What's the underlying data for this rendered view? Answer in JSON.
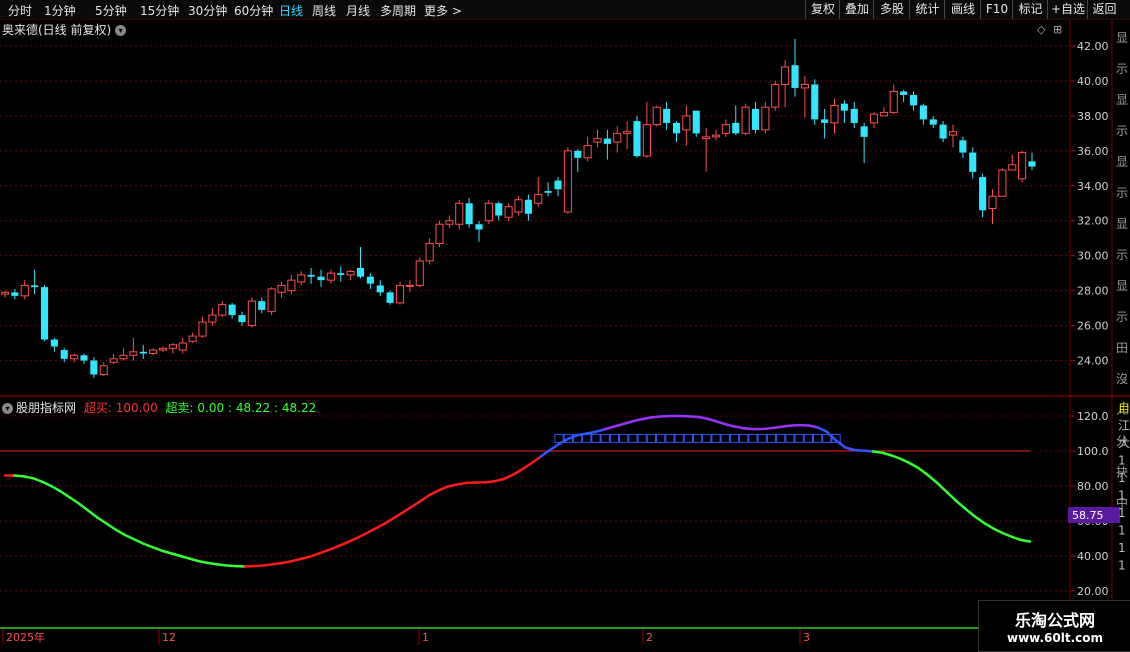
{
  "toolbar": {
    "periods": [
      "分时",
      "1分钟",
      "5分钟",
      "15分钟",
      "30分钟",
      "60分钟",
      "日线",
      "周线",
      "月线",
      "多周期",
      "更多 >"
    ],
    "active_period": "日线",
    "right_buttons": [
      "复权",
      "叠加",
      "多股",
      "统计",
      "画线",
      "F10",
      "标记",
      "+自选",
      "返回"
    ]
  },
  "main_chart": {
    "title": "奥来德(日线 前复权)",
    "y_ticks": [
      "42.00",
      "40.00",
      "38.00",
      "36.00",
      "34.00",
      "32.00",
      "30.00",
      "28.00",
      "26.00",
      "24.00"
    ],
    "right_panel_glyphs": "显示显示显示显示显示田沒ㄦ分抉中"
  },
  "indicator": {
    "name": "股朋指标网",
    "label_buy": "超买:",
    "value_buy": "100.00",
    "label_sell": "超卖:",
    "value_sell": "0.00",
    "value_line1": ": 48.22",
    "value_line2": ": 48.22",
    "y_ticks": [
      "120.0",
      "100.0",
      "80.00",
      "60.00",
      "40.00",
      "20.00"
    ],
    "current_value": "58.75",
    "right_panel_glyphs": "自江大1111111"
  },
  "x_axis": {
    "labels": [
      "2025年",
      "12",
      "1",
      "2",
      "3"
    ]
  },
  "watermark": {
    "line1": "乐淘公式网",
    "line2": "www.60lt.com"
  },
  "colors": {
    "up": "#ff4d4d",
    "down": "#33e6ff",
    "grid": "#6a0000",
    "line_green": "#33ff33",
    "line_red": "#ff1a1a",
    "line_blue": "#3355ff",
    "line_purple": "#9933ff",
    "badge": "#5a1aa0"
  },
  "chart_data": {
    "type": "candlestick",
    "title": "奥来德(日线 前复权)",
    "ylim": [
      22.5,
      43.5
    ],
    "candles": [
      [
        27.8,
        27.9,
        27.6,
        28.0
      ],
      [
        27.9,
        27.7,
        27.5,
        28.1
      ],
      [
        27.7,
        28.3,
        27.5,
        28.6
      ],
      [
        28.3,
        28.2,
        27.8,
        29.2
      ],
      [
        28.2,
        25.2,
        25.1,
        28.3
      ],
      [
        25.2,
        24.8,
        24.5,
        25.3
      ],
      [
        24.6,
        24.1,
        23.9,
        24.7
      ],
      [
        24.1,
        24.3,
        23.9,
        24.4
      ],
      [
        24.3,
        24.0,
        23.8,
        24.4
      ],
      [
        24.0,
        23.2,
        23.0,
        24.2
      ],
      [
        23.2,
        23.7,
        23.1,
        23.9
      ],
      [
        23.9,
        24.1,
        23.8,
        24.4
      ],
      [
        24.1,
        24.3,
        24.0,
        24.7
      ],
      [
        24.3,
        24.5,
        24.0,
        25.3
      ],
      [
        24.5,
        24.4,
        24.1,
        24.9
      ],
      [
        24.4,
        24.6,
        24.3,
        24.7
      ],
      [
        24.6,
        24.7,
        24.5,
        24.8
      ],
      [
        24.7,
        24.9,
        24.4,
        25.0
      ],
      [
        24.6,
        25.0,
        24.4,
        25.3
      ],
      [
        25.1,
        25.4,
        25.0,
        25.6
      ],
      [
        25.4,
        26.2,
        25.3,
        26.5
      ],
      [
        26.2,
        26.6,
        26.0,
        27.0
      ],
      [
        26.6,
        27.2,
        26.5,
        27.4
      ],
      [
        27.2,
        26.6,
        26.4,
        27.3
      ],
      [
        26.6,
        26.2,
        26.0,
        26.8
      ],
      [
        26.0,
        27.4,
        25.9,
        27.6
      ],
      [
        27.4,
        26.9,
        26.7,
        27.6
      ],
      [
        26.8,
        28.1,
        26.6,
        28.2
      ],
      [
        27.9,
        28.3,
        27.6,
        28.5
      ],
      [
        28.0,
        28.6,
        27.8,
        28.9
      ],
      [
        28.5,
        28.9,
        28.3,
        29.1
      ],
      [
        28.9,
        28.8,
        28.4,
        29.3
      ],
      [
        28.8,
        28.6,
        28.2,
        29.2
      ],
      [
        28.6,
        29.0,
        28.4,
        29.2
      ],
      [
        29.0,
        28.9,
        28.5,
        29.4
      ],
      [
        28.9,
        29.1,
        28.6,
        29.2
      ],
      [
        29.3,
        28.8,
        28.7,
        30.5
      ],
      [
        28.8,
        28.4,
        28.1,
        29.0
      ],
      [
        28.3,
        27.9,
        27.7,
        28.6
      ],
      [
        27.9,
        27.3,
        27.2,
        28.0
      ],
      [
        27.3,
        28.3,
        27.2,
        28.5
      ],
      [
        28.3,
        28.3,
        27.9,
        28.6
      ],
      [
        28.3,
        29.7,
        28.2,
        29.9
      ],
      [
        29.7,
        30.7,
        29.5,
        31.0
      ],
      [
        30.7,
        31.8,
        30.5,
        32.0
      ],
      [
        31.8,
        32.0,
        31.6,
        32.3
      ],
      [
        31.8,
        33.0,
        31.5,
        33.2
      ],
      [
        33.0,
        31.8,
        31.6,
        33.3
      ],
      [
        31.8,
        31.5,
        30.8,
        32.0
      ],
      [
        32.0,
        33.0,
        31.8,
        33.2
      ],
      [
        33.0,
        32.3,
        32.0,
        33.1
      ],
      [
        32.2,
        32.8,
        32.0,
        33.0
      ],
      [
        32.5,
        33.2,
        32.3,
        33.4
      ],
      [
        33.2,
        32.4,
        32.0,
        33.5
      ],
      [
        33.0,
        33.5,
        32.8,
        34.5
      ],
      [
        33.7,
        33.6,
        33.4,
        34.2
      ],
      [
        34.3,
        33.8,
        33.4,
        34.5
      ],
      [
        32.5,
        36.0,
        32.4,
        36.2
      ],
      [
        36.0,
        35.6,
        34.8,
        36.1
      ],
      [
        35.6,
        36.3,
        35.4,
        36.8
      ],
      [
        36.5,
        36.7,
        36.2,
        37.2
      ],
      [
        36.7,
        36.4,
        35.5,
        37.2
      ],
      [
        36.5,
        37.0,
        35.9,
        37.4
      ],
      [
        37.0,
        37.1,
        36.1,
        37.7
      ],
      [
        37.7,
        35.7,
        35.6,
        38.0
      ],
      [
        35.7,
        37.5,
        35.6,
        38.8
      ],
      [
        37.5,
        38.5,
        37.4,
        38.6
      ],
      [
        38.4,
        37.6,
        37.2,
        38.8
      ],
      [
        37.6,
        37.0,
        36.5,
        37.7
      ],
      [
        37.2,
        38.0,
        36.3,
        38.6
      ],
      [
        38.3,
        37.0,
        36.8,
        38.3
      ],
      [
        36.7,
        36.8,
        34.8,
        37.3
      ],
      [
        36.8,
        36.9,
        36.6,
        37.2
      ],
      [
        37.0,
        37.5,
        36.8,
        37.8
      ],
      [
        37.6,
        37.0,
        36.9,
        38.6
      ],
      [
        37.0,
        38.5,
        36.9,
        38.7
      ],
      [
        38.4,
        37.2,
        37.0,
        38.8
      ],
      [
        37.2,
        38.5,
        37.0,
        38.8
      ],
      [
        38.5,
        39.8,
        38.3,
        40.0
      ],
      [
        39.8,
        40.8,
        38.5,
        41.2
      ],
      [
        40.9,
        39.6,
        39.1,
        42.4
      ],
      [
        39.6,
        39.8,
        37.9,
        40.3
      ],
      [
        39.8,
        37.8,
        37.5,
        40.1
      ],
      [
        37.8,
        37.6,
        36.7,
        38.4
      ],
      [
        37.6,
        38.6,
        37.0,
        39.0
      ],
      [
        38.7,
        38.3,
        37.6,
        38.9
      ],
      [
        38.4,
        37.6,
        37.3,
        38.8
      ],
      [
        37.4,
        36.8,
        35.3,
        37.6
      ],
      [
        37.6,
        38.1,
        37.3,
        38.2
      ],
      [
        38.0,
        38.2,
        38.0,
        38.5
      ],
      [
        38.2,
        39.4,
        38.1,
        39.8
      ],
      [
        39.4,
        39.2,
        38.8,
        39.5
      ],
      [
        39.2,
        38.6,
        38.3,
        39.4
      ],
      [
        38.6,
        37.8,
        37.5,
        38.7
      ],
      [
        37.8,
        37.5,
        37.3,
        38.0
      ],
      [
        37.5,
        36.7,
        36.5,
        37.7
      ],
      [
        36.9,
        37.1,
        36.2,
        37.5
      ],
      [
        36.6,
        35.9,
        35.6,
        36.8
      ],
      [
        35.9,
        34.8,
        34.4,
        36.2
      ],
      [
        34.5,
        32.6,
        32.2,
        34.7
      ],
      [
        32.7,
        33.4,
        31.8,
        33.8
      ],
      [
        33.4,
        34.9,
        33.4,
        35.0
      ],
      [
        34.9,
        35.2,
        34.9,
        35.8
      ],
      [
        34.4,
        35.9,
        34.2,
        36.0
      ],
      [
        35.4,
        35.1,
        34.9,
        35.9
      ]
    ],
    "indicator": {
      "ylim": [
        10,
        130
      ],
      "levels": {
        "超买": 100,
        "超卖": 0
      },
      "value_label": 58.75,
      "curve": [
        86,
        86,
        85.5,
        84.5,
        82.5,
        80,
        77,
        73.5,
        70,
        66,
        62,
        58.5,
        55,
        52,
        49.5,
        47,
        45,
        43,
        41.5,
        40,
        38.5,
        37,
        36,
        35.2,
        34.6,
        34.2,
        34,
        34.2,
        34.6,
        35.3,
        36,
        37,
        38.3,
        39.6,
        41.4,
        43.4,
        45.4,
        47.6,
        50,
        52.6,
        55.4,
        58.2,
        61.4,
        64.6,
        68,
        71.4,
        74.9,
        77.6,
        79.8,
        80.9,
        81.8,
        82,
        82.1,
        82.7,
        84,
        86.4,
        89.5,
        93,
        96.7,
        100.5,
        104,
        107,
        109,
        110,
        111,
        112.5,
        114,
        115.5,
        117,
        118.2,
        119.2,
        119.7,
        120,
        120,
        119.8,
        119.5,
        118.5,
        117,
        115.3,
        114,
        113,
        112.5,
        112.6,
        113.1,
        113.8,
        114.5,
        114.8,
        114.6,
        113.5,
        111,
        106,
        102,
        100.5,
        100.2,
        99.8,
        99,
        97.5,
        95.5,
        93,
        90,
        86,
        81.5,
        76.5,
        71.5,
        67,
        62.7,
        59,
        55.8,
        53.2,
        51,
        49.2,
        48.22
      ]
    }
  }
}
